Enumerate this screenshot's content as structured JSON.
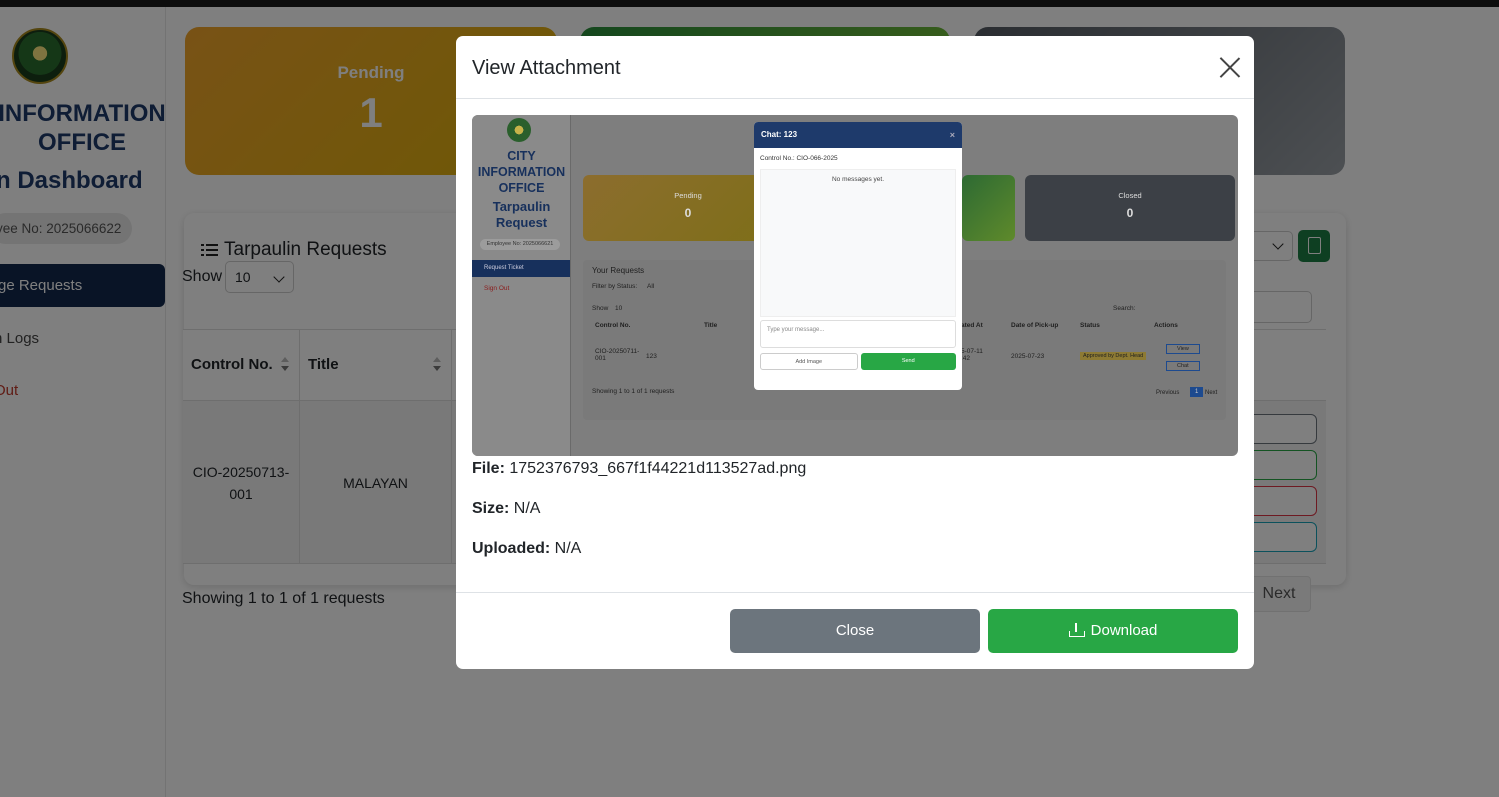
{
  "sidebar": {
    "org_name": "INFORMATION\nOFFICE",
    "dashboard_title": "n Dashboard",
    "employee_no": "yee No: 2025066622",
    "nav_active": "ge Requests",
    "nav_logs": "n Logs",
    "nav_signout": "Out"
  },
  "cards": {
    "pending_label": "Pending",
    "pending_count": "1"
  },
  "requests": {
    "title": "Tarpaulin Requests",
    "show_label": "Show",
    "show_value": "10",
    "columns": [
      "Control No.",
      "Title"
    ],
    "rows": [
      {
        "control_no": "CIO-20250713-001",
        "title": "MALAYAN"
      }
    ],
    "showing_text": "Showing 1 to 1 of 1 requests",
    "next_label": "Next"
  },
  "modal": {
    "title": "View Attachment",
    "file_label": "File:",
    "file_value": "1752376793_667f1f44221d113527ad.png",
    "size_label": "Size:",
    "size_value": "N/A",
    "uploaded_label": "Uploaded:",
    "uploaded_value": "N/A",
    "close_label": "Close",
    "download_label": "Download"
  },
  "preview": {
    "org_name": "CITY\nINFORMATION\nOFFICE",
    "sub_title": "Tarpaulin\nRequest",
    "employee_no": "Employee No: 2025066621",
    "nav_request": "Request Ticket",
    "nav_signout": "Sign Out",
    "card_pending": "Pending",
    "card_pending_count": "0",
    "card_closed": "Closed",
    "card_closed_count": "0",
    "your_requests": "Your Requests",
    "filter_label": "Filter by Status:",
    "filter_value": "All",
    "show_label": "Show",
    "show_value": "10",
    "search_label": "Search:",
    "col_control": "Control No.",
    "col_title": "Title",
    "col_created": "ated At",
    "col_pickup": "Date of Pick-up",
    "col_status": "Status",
    "col_actions": "Actions",
    "row_control": "CIO-20250711-\n001",
    "row_title": "123",
    "row_created": "5-07-11\n:42",
    "row_pickup": "2025-07-23",
    "row_status": "Approved by Dept. Head",
    "btn_view": "View",
    "btn_chat": "Chat",
    "showing": "Showing 1 to 1 of 1 requests",
    "prev": "Previous",
    "page": "1",
    "next": "Next",
    "chat_title": "Chat: 123",
    "chat_control": "Control No.: CIO-066-2025",
    "chat_empty": "No messages yet.",
    "chat_placeholder": "Type your message...",
    "chat_add_image": "Add Image",
    "chat_send": "Send"
  }
}
